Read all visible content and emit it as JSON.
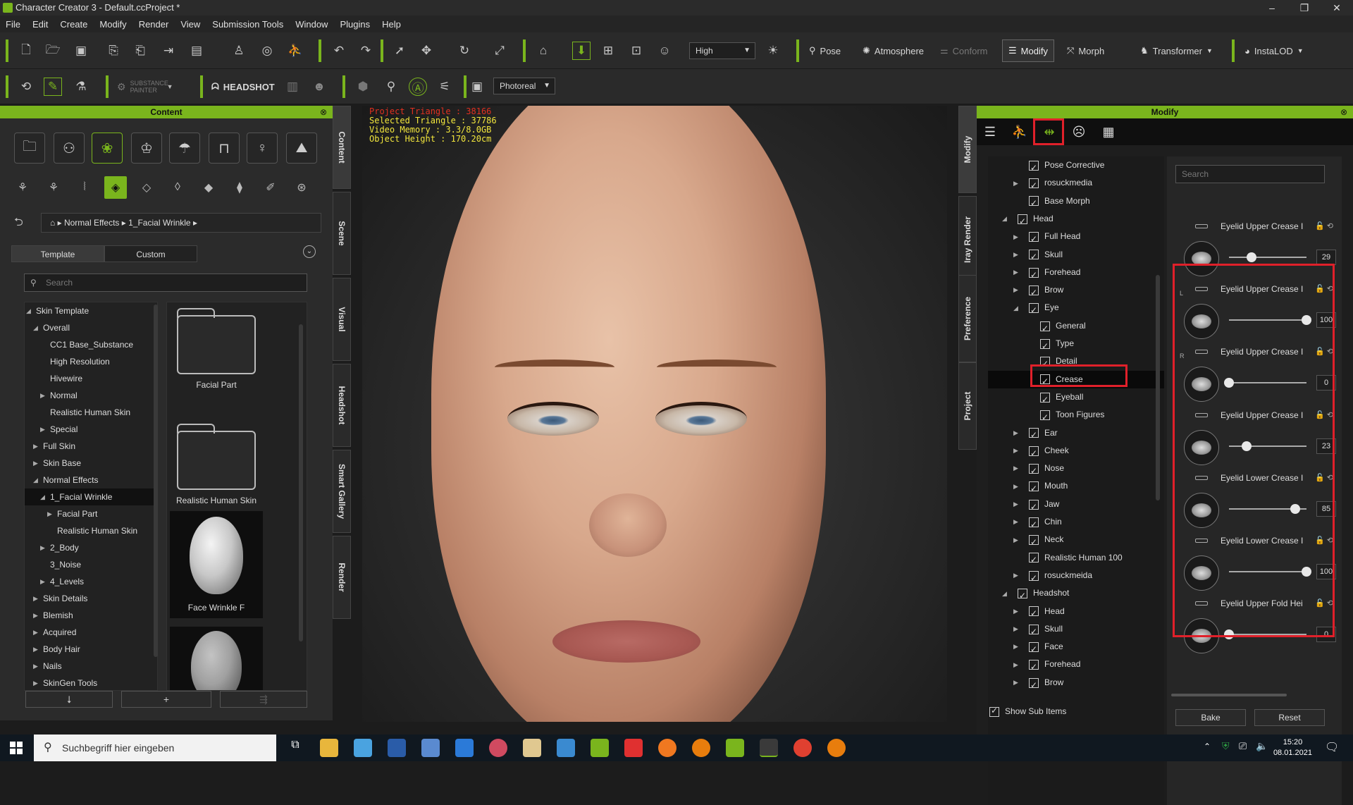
{
  "window": {
    "title": "Character Creator 3 - Default.ccProject *",
    "controls": [
      "–",
      "❐",
      "✕"
    ]
  },
  "menu": [
    "File",
    "Edit",
    "Create",
    "Modify",
    "Render",
    "View",
    "Submission Tools",
    "Window",
    "Plugins",
    "Help"
  ],
  "toolbar": {
    "quality_value": "High",
    "pose_label": "Pose",
    "atmosphere_label": "Atmosphere",
    "conform_label": "Conform",
    "modify_label": "Modify",
    "morph_label": "Morph",
    "transformer_label": "Transformer",
    "instalod_label": "InstaLOD",
    "substance_label": "SUBSTANCE PAINTER",
    "headshot_label": "HEADSHOT",
    "render_mode_value": "Photoreal"
  },
  "content_panel": {
    "title": "Content",
    "breadcrumb": [
      "Normal Effects",
      "1_Facial Wrinkle"
    ],
    "tabs": [
      "Template",
      "Custom"
    ],
    "search_placeholder": "Search",
    "tree": [
      {
        "label": "Skin Template",
        "indent": 0,
        "toggle": "open"
      },
      {
        "label": "Overall",
        "indent": 1,
        "toggle": "open"
      },
      {
        "label": "CC1 Base_Substance",
        "indent": 2,
        "toggle": ""
      },
      {
        "label": "High Resolution",
        "indent": 2,
        "toggle": ""
      },
      {
        "label": "Hivewire",
        "indent": 2,
        "toggle": ""
      },
      {
        "label": "Normal",
        "indent": 2,
        "toggle": "closed"
      },
      {
        "label": "Realistic Human Skin",
        "indent": 2,
        "toggle": ""
      },
      {
        "label": "Special",
        "indent": 2,
        "toggle": "closed"
      },
      {
        "label": "Full Skin",
        "indent": 1,
        "toggle": "closed"
      },
      {
        "label": "Skin Base",
        "indent": 1,
        "toggle": "closed"
      },
      {
        "label": "Normal Effects",
        "indent": 1,
        "toggle": "open"
      },
      {
        "label": "1_Facial Wrinkle",
        "indent": 2,
        "toggle": "open",
        "selected": true
      },
      {
        "label": "Facial Part",
        "indent": 3,
        "toggle": "closed"
      },
      {
        "label": "Realistic Human Skin",
        "indent": 3,
        "toggle": ""
      },
      {
        "label": "2_Body",
        "indent": 2,
        "toggle": "closed"
      },
      {
        "label": "3_Noise",
        "indent": 2,
        "toggle": ""
      },
      {
        "label": "4_Levels",
        "indent": 2,
        "toggle": "closed"
      },
      {
        "label": "Skin Details",
        "indent": 1,
        "toggle": "closed"
      },
      {
        "label": "Blemish",
        "indent": 1,
        "toggle": "closed"
      },
      {
        "label": "Acquired",
        "indent": 1,
        "toggle": "closed"
      },
      {
        "label": "Body Hair",
        "indent": 1,
        "toggle": "closed"
      },
      {
        "label": "Nails",
        "indent": 1,
        "toggle": "closed"
      },
      {
        "label": "SkinGen Tools",
        "indent": 1,
        "toggle": "closed"
      }
    ],
    "thumbnails": [
      "Facial Part",
      "Realistic Human Skin",
      "Face Wrinkle F"
    ],
    "side_tabs": [
      "Content",
      "Scene",
      "Visual",
      "Headshot",
      "Smart Gallery",
      "Render"
    ]
  },
  "viewport": {
    "stats": [
      {
        "text": "Project Triangle : 38166",
        "highlight": true
      },
      {
        "text": "Selected Triangle : 37786",
        "highlight": false
      },
      {
        "text": "Video Memory : 3.3/8.0GB",
        "highlight": false
      },
      {
        "text": "Object Height : 170.20cm",
        "highlight": false
      }
    ]
  },
  "modify_panel": {
    "title": "Modify",
    "side_tabs": [
      "Modify",
      "Iray Render",
      "Preference",
      "Project"
    ],
    "tree": [
      {
        "label": "Pose Corrective",
        "indent": 1,
        "toggle": ""
      },
      {
        "label": "rosuckmedia",
        "indent": 1,
        "toggle": "closed"
      },
      {
        "label": "Base Morph",
        "indent": 1,
        "toggle": ""
      },
      {
        "label": "Head",
        "indent": 0,
        "toggle": "open"
      },
      {
        "label": "Full Head",
        "indent": 1,
        "toggle": "closed"
      },
      {
        "label": "Skull",
        "indent": 1,
        "toggle": "closed"
      },
      {
        "label": "Forehead",
        "indent": 1,
        "toggle": "closed"
      },
      {
        "label": "Brow",
        "indent": 1,
        "toggle": "closed"
      },
      {
        "label": "Eye",
        "indent": 1,
        "toggle": "open"
      },
      {
        "label": "General",
        "indent": 2,
        "toggle": ""
      },
      {
        "label": "Type",
        "indent": 2,
        "toggle": ""
      },
      {
        "label": "Detail",
        "indent": 2,
        "toggle": ""
      },
      {
        "label": "Crease",
        "indent": 2,
        "toggle": "",
        "selected": true
      },
      {
        "label": "Eyeball",
        "indent": 2,
        "toggle": ""
      },
      {
        "label": "Toon Figures",
        "indent": 2,
        "toggle": ""
      },
      {
        "label": "Ear",
        "indent": 1,
        "toggle": "closed"
      },
      {
        "label": "Cheek",
        "indent": 1,
        "toggle": "closed"
      },
      {
        "label": "Nose",
        "indent": 1,
        "toggle": "closed"
      },
      {
        "label": "Mouth",
        "indent": 1,
        "toggle": "closed"
      },
      {
        "label": "Jaw",
        "indent": 1,
        "toggle": "closed"
      },
      {
        "label": "Chin",
        "indent": 1,
        "toggle": "closed"
      },
      {
        "label": "Neck",
        "indent": 1,
        "toggle": "closed"
      },
      {
        "label": "Realistic Human 100",
        "indent": 1,
        "toggle": ""
      },
      {
        "label": "rosuckmeida",
        "indent": 1,
        "toggle": "closed"
      },
      {
        "label": "Headshot",
        "indent": 0,
        "toggle": "open"
      },
      {
        "label": "Head",
        "indent": 1,
        "toggle": "closed"
      },
      {
        "label": "Skull",
        "indent": 1,
        "toggle": "closed"
      },
      {
        "label": "Face",
        "indent": 1,
        "toggle": "closed"
      },
      {
        "label": "Forehead",
        "indent": 1,
        "toggle": "closed"
      },
      {
        "label": "Brow",
        "indent": 1,
        "toggle": "closed"
      }
    ],
    "search_placeholder": "Search",
    "sliders": [
      {
        "label": "Eyelid Upper Crease I",
        "side": "",
        "value": "29",
        "fraction": 0.29
      },
      {
        "label": "Eyelid Upper Crease I",
        "side": "L",
        "value": "100",
        "fraction": 1.0
      },
      {
        "label": "Eyelid Upper Crease I",
        "side": "R",
        "value": "0",
        "fraction": 0.0
      },
      {
        "label": "Eyelid Upper Crease I",
        "side": "",
        "value": "23",
        "fraction": 0.23
      },
      {
        "label": "Eyelid Lower Crease I",
        "side": "",
        "value": "85",
        "fraction": 0.85
      },
      {
        "label": "Eyelid Lower Crease I",
        "side": "",
        "value": "100",
        "fraction": 1.0
      },
      {
        "label": "Eyelid Upper Fold Hei",
        "side": "",
        "value": "0",
        "fraction": 0.0
      }
    ],
    "bake_label": "Bake",
    "reset_label": "Reset",
    "show_sub_items": "Show Sub Items"
  },
  "taskbar": {
    "search_placeholder": "Suchbegriff hier eingeben",
    "time": "15:20",
    "date": "08.01.2021"
  },
  "colors": {
    "accent": "#7ab51d",
    "highlight_box": "#e0202a"
  }
}
